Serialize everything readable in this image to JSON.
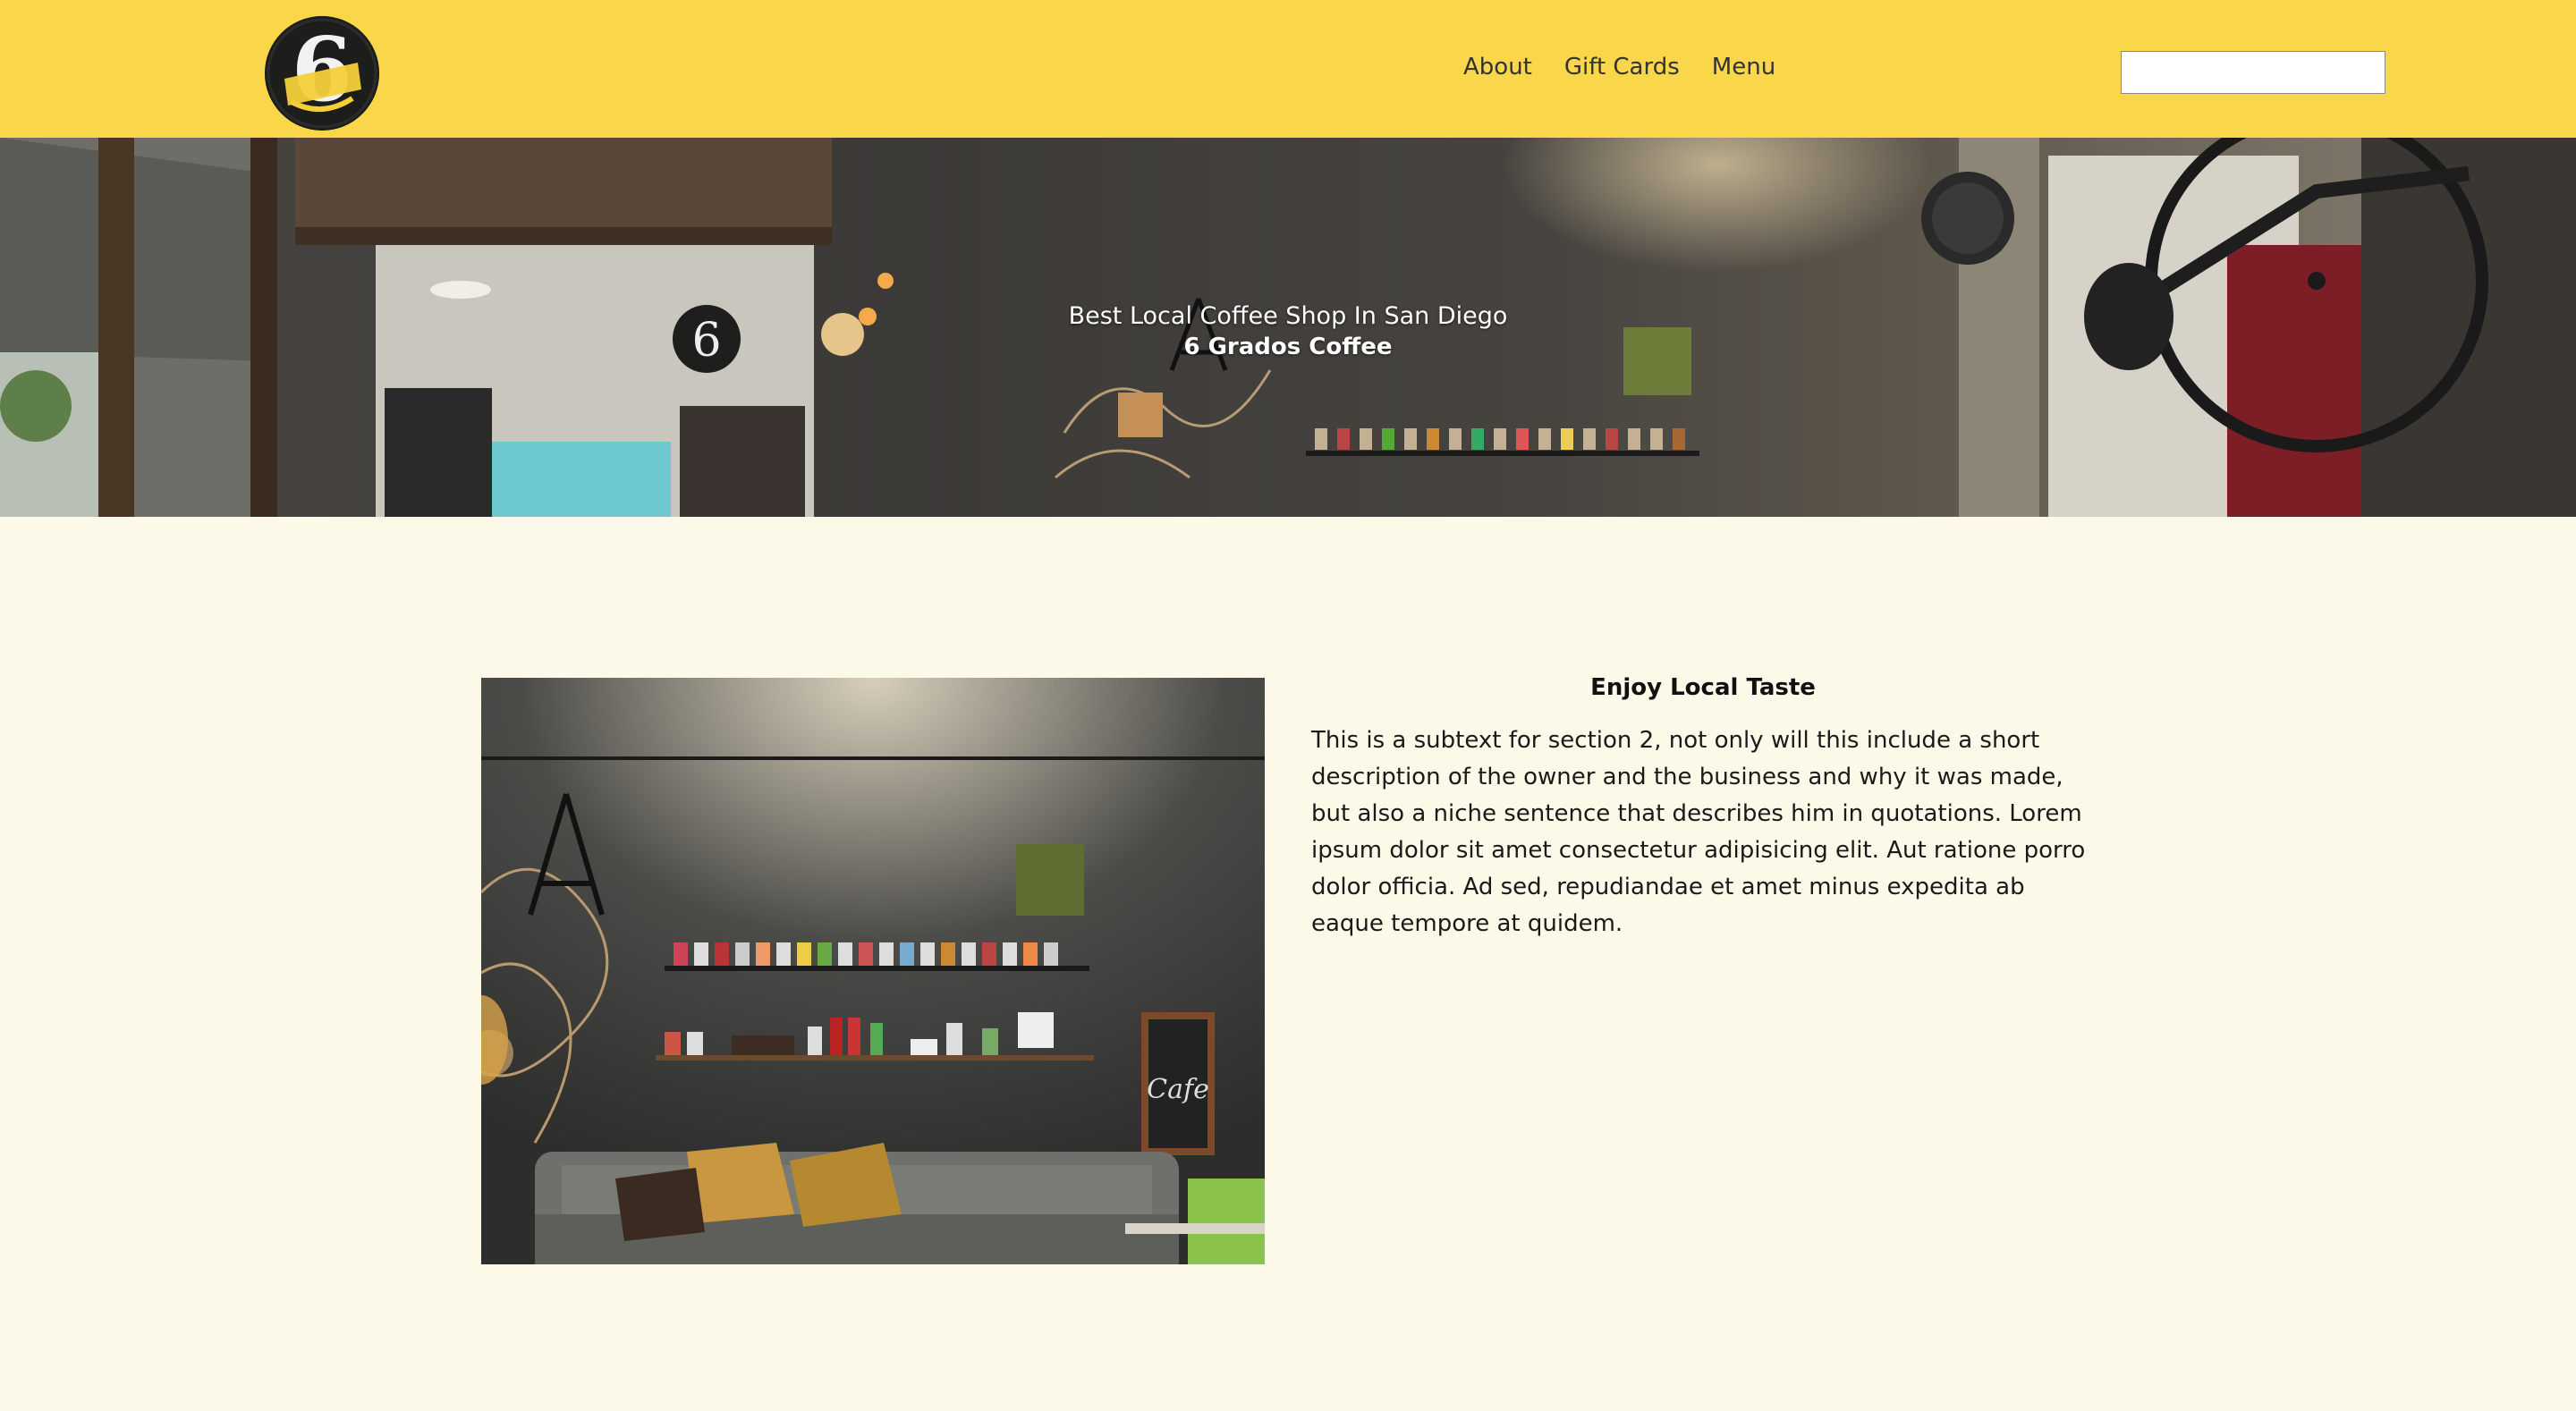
{
  "header": {
    "logo_alt": "6 Grados Coffee logo",
    "logo_icon": "coffee-logo-six",
    "nav": [
      {
        "label": "About"
      },
      {
        "label": "Gift Cards"
      },
      {
        "label": "Menu"
      }
    ],
    "search": {
      "value": "",
      "placeholder": ""
    }
  },
  "hero": {
    "subtitle": "Best Local Coffee Shop In San Diego",
    "title": "6 Grados Coffee"
  },
  "section2": {
    "title": "Enjoy Local Taste",
    "body": "This is a subtext for section 2, not only will this include a short description of the owner and the business and why it was made, but also a niche sentence that describes him in quotations. Lorem ipsum dolor sit amet consectetur adipisicing elit. Aut ratione porro dolor officia. Ad sed, repudiandae et amet minus expedita ab eaque tempore at quidem."
  },
  "colors": {
    "header_bg": "#fad64b",
    "page_bg": "#fdf9e8",
    "text": "#222222"
  }
}
